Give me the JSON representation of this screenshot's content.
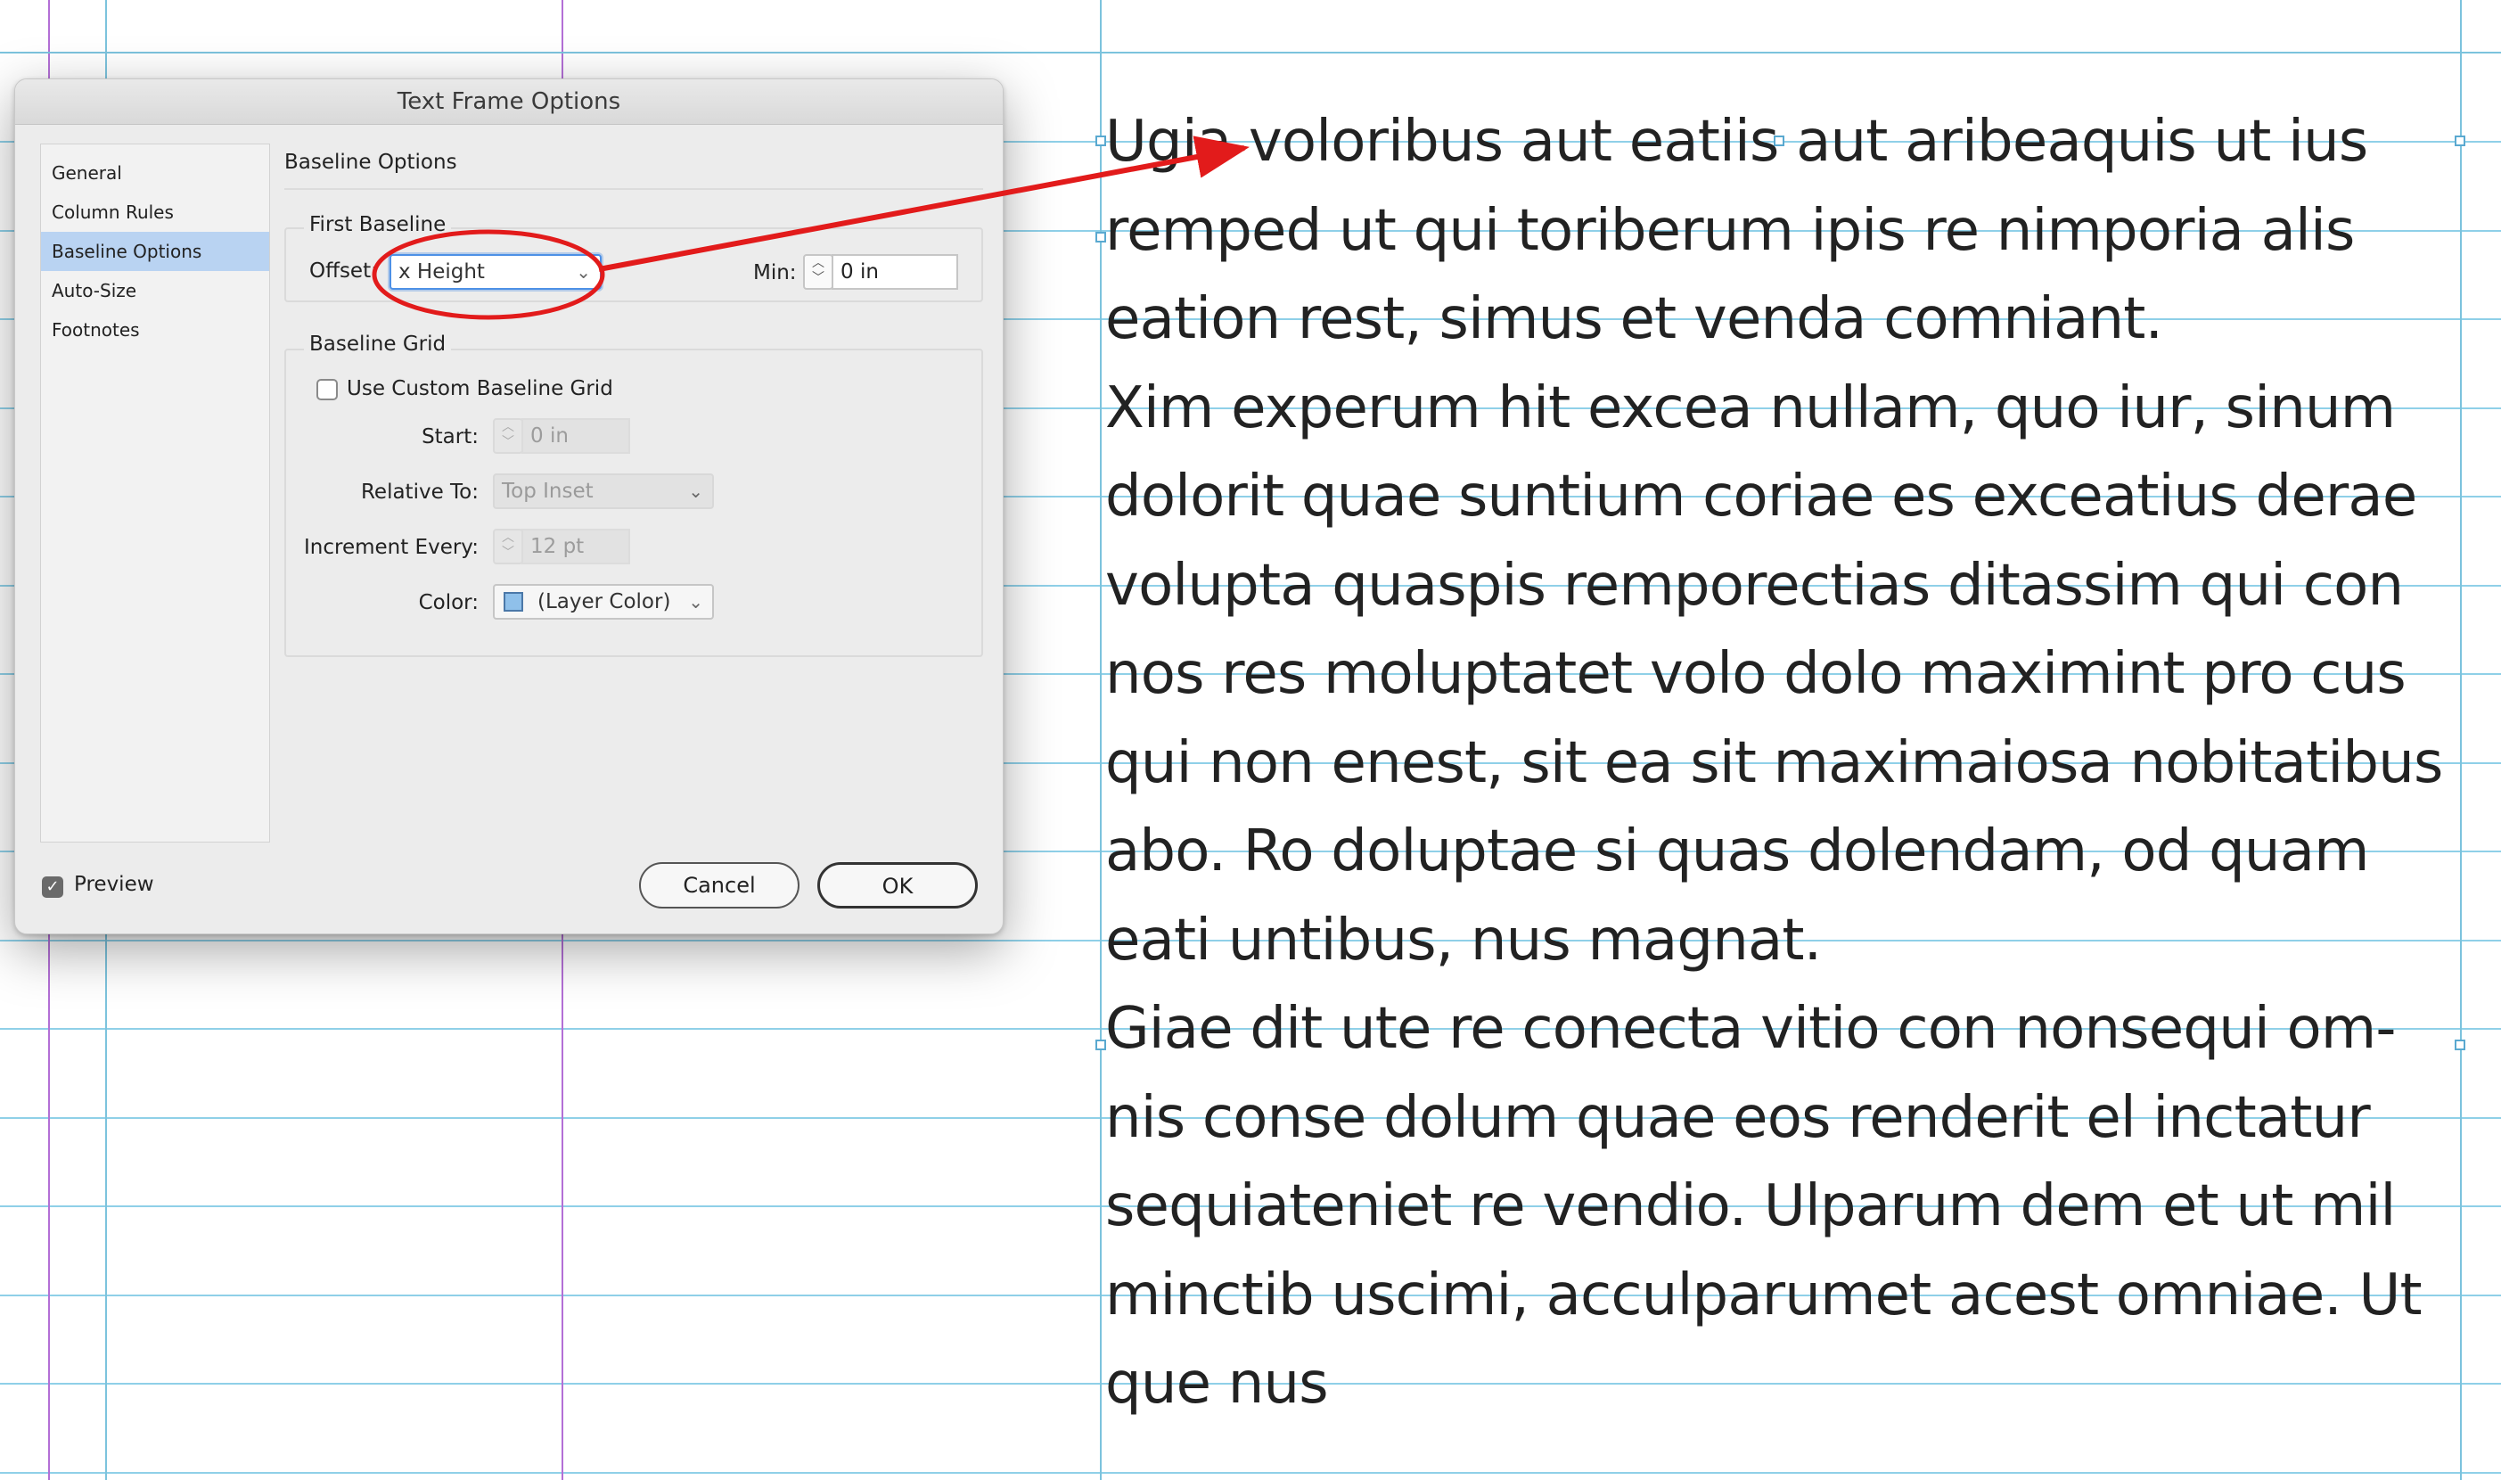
{
  "dialog": {
    "title": "Text Frame Options",
    "sidebar_items": [
      "General",
      "Column Rules",
      "Baseline Options",
      "Auto-Size",
      "Footnotes"
    ],
    "selected_item": "Baseline Options",
    "section_title": "Baseline Options",
    "first_baseline": {
      "legend": "First Baseline",
      "offset_label": "Offset:",
      "offset_value": "x Height",
      "min_label": "Min:",
      "min_value": "0 in"
    },
    "baseline_grid": {
      "legend": "Baseline Grid",
      "use_custom_label": "Use Custom Baseline Grid",
      "use_custom_checked": false,
      "start_label": "Start:",
      "start_value": "0 in",
      "relative_to_label": "Relative To:",
      "relative_to_value": "Top Inset",
      "increment_label": "Increment Every:",
      "increment_value": "12 pt",
      "color_label": "Color:",
      "color_value": "(Layer Color)",
      "color_swatch": "#8fc0ea"
    },
    "preview_label": "Preview",
    "preview_checked": true,
    "cancel_label": "Cancel",
    "ok_label": "OK"
  },
  "document": {
    "paragraphs": [
      [
        "Ugia voloribus aut eatiis aut aribeaquis ut ius",
        "remped ut qui toriberum ipis re nimporia alis",
        "eation rest, simus et venda comniant."
      ],
      [
        "Xim experum hit excea nullam, quo iur, sinum",
        "dolorit quae suntium coriae es exceatius derae",
        "volupta quaspis remporectias ditassim qui con",
        "nos res moluptatet volo dolo maximint pro cus",
        "qui non enest, sit ea sit maximaiosa nobitatibus",
        "abo. Ro doluptae si quas dolendam, od quam",
        "eati untibus, nus magnat."
      ],
      [
        "Giae dit ute re conecta vitio con nonsequi om-",
        "nis conse dolum quae eos renderit el inctatur",
        "sequiateniet re vendio. Ulparum dem et ut mil",
        "minctib uscimi, acculparumet acest omniae. Ut",
        "que nus"
      ]
    ],
    "grid_color": "#8fd0e8",
    "guide_color": "#b36fd6",
    "annotation_color": "#e21b1b"
  }
}
